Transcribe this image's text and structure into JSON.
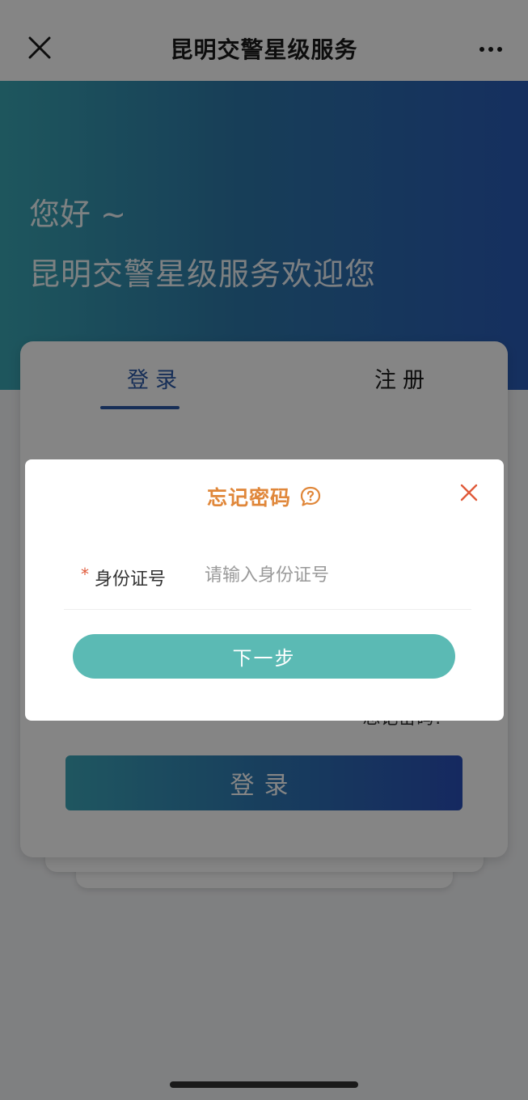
{
  "navbar": {
    "title": "昆明交警星级服务",
    "close_icon": "close-icon",
    "more_icon": "more-icon"
  },
  "hero": {
    "greeting": "您好 ~",
    "welcome": "昆明交警星级服务欢迎您"
  },
  "login_card": {
    "tabs": [
      {
        "label": "登录",
        "active": true
      },
      {
        "label": "注册",
        "active": false
      }
    ],
    "forgot_password_label": "忘记密码?",
    "login_button_label": "登录"
  },
  "modal": {
    "title": "忘记密码",
    "help_icon": "help-icon",
    "close_icon": "close-icon",
    "field": {
      "required_mark": "*",
      "label": "身份证号",
      "placeholder": "请输入身份证号",
      "value": ""
    },
    "next_button_label": "下一步"
  },
  "colors": {
    "accent_orange": "#e0873a",
    "primary_teal": "#5bbab4",
    "tab_active_blue": "#2b58a8",
    "required_red": "#e05a3a"
  }
}
